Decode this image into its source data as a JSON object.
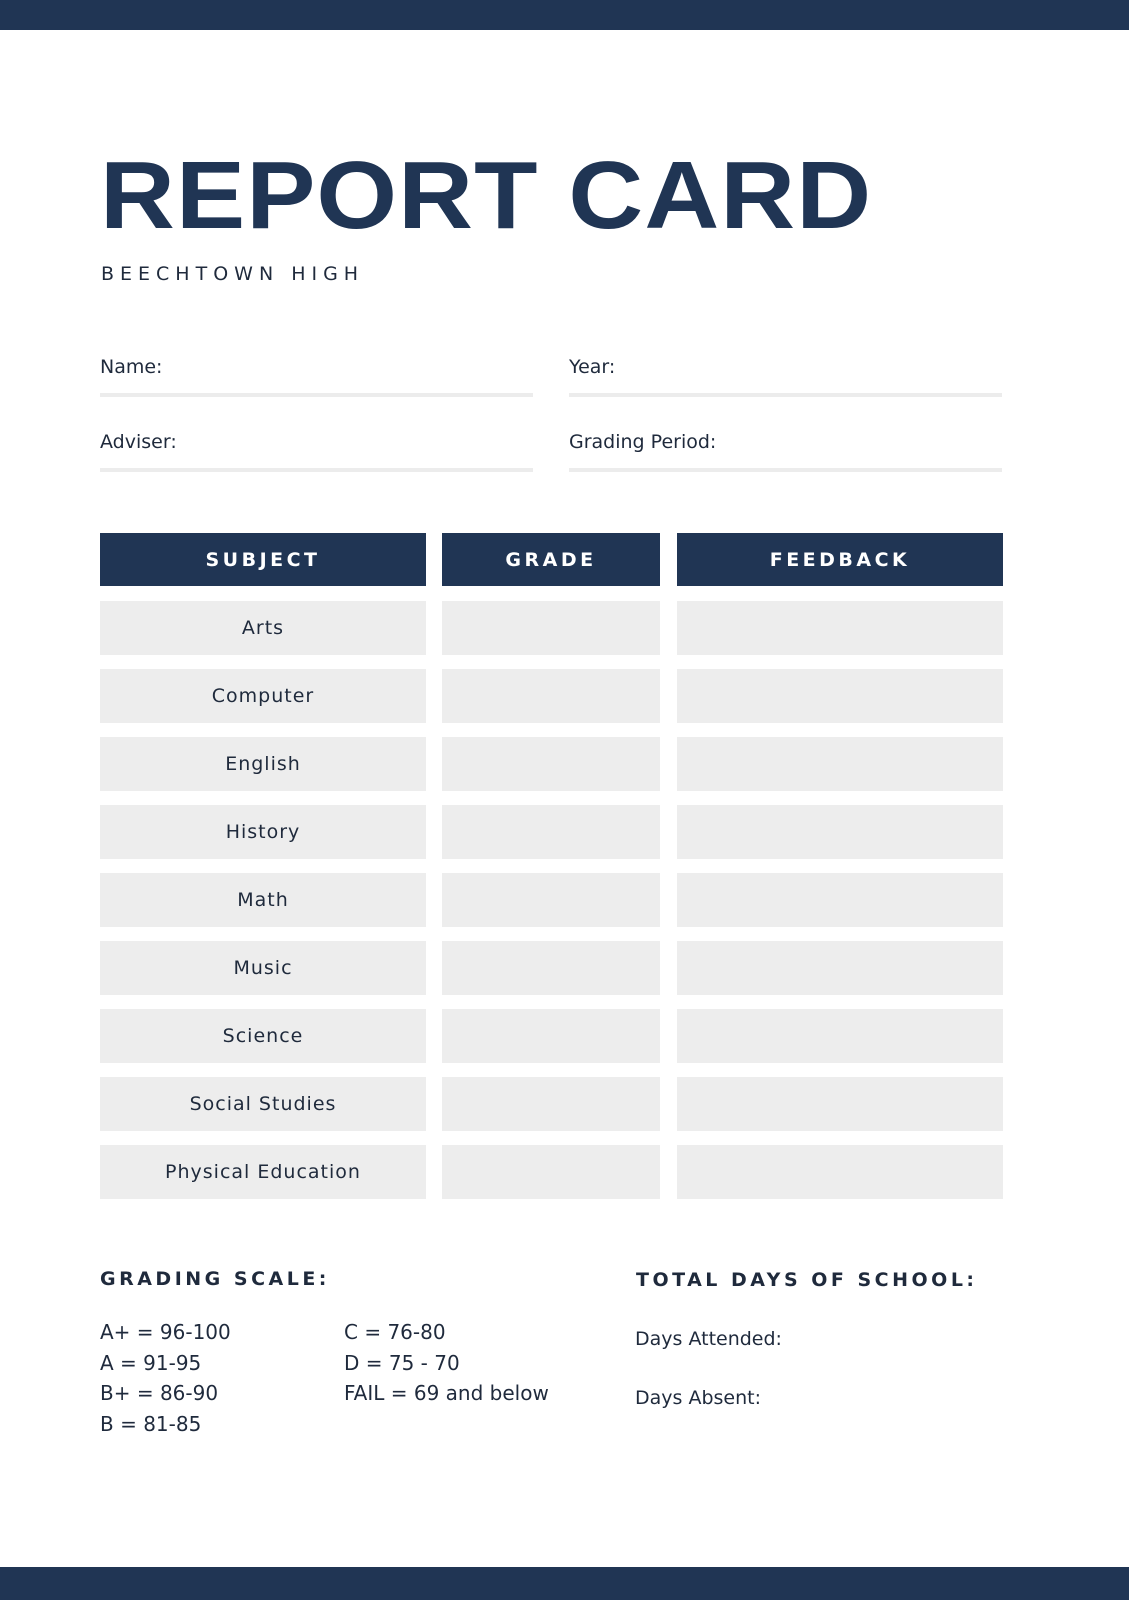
{
  "document": {
    "title": "REPORT CARD",
    "school": "BEECHTOWN HIGH",
    "colors": {
      "primary": "#203554",
      "cell_background": "#ededed",
      "field_line": "#ececec"
    }
  },
  "fields": {
    "name_label": "Name:",
    "year_label": "Year:",
    "adviser_label": "Adviser:",
    "grading_period_label": "Grading Period:"
  },
  "table": {
    "headers": [
      "SUBJECT",
      "GRADE",
      "FEEDBACK"
    ],
    "rows": [
      {
        "subject": "Arts",
        "grade": "",
        "feedback": ""
      },
      {
        "subject": "Computer",
        "grade": "",
        "feedback": ""
      },
      {
        "subject": "English",
        "grade": "",
        "feedback": ""
      },
      {
        "subject": "History",
        "grade": "",
        "feedback": ""
      },
      {
        "subject": "Math",
        "grade": "",
        "feedback": ""
      },
      {
        "subject": "Music",
        "grade": "",
        "feedback": ""
      },
      {
        "subject": "Science",
        "grade": "",
        "feedback": ""
      },
      {
        "subject": "Social Studies",
        "grade": "",
        "feedback": ""
      },
      {
        "subject": "Physical Education",
        "grade": "",
        "feedback": ""
      }
    ]
  },
  "grading_scale": {
    "heading": "GRADING SCALE:",
    "column1": [
      "A+ = 96-100",
      "A = 91-95",
      "B+ = 86-90",
      "B = 81-85"
    ],
    "column2": [
      "C = 76-80",
      "D = 75 - 70",
      "FAIL = 69 and below"
    ]
  },
  "attendance": {
    "heading": "TOTAL DAYS OF SCHOOL:",
    "days_attended_label": "Days Attended:",
    "days_absent_label": "Days Absent:"
  }
}
